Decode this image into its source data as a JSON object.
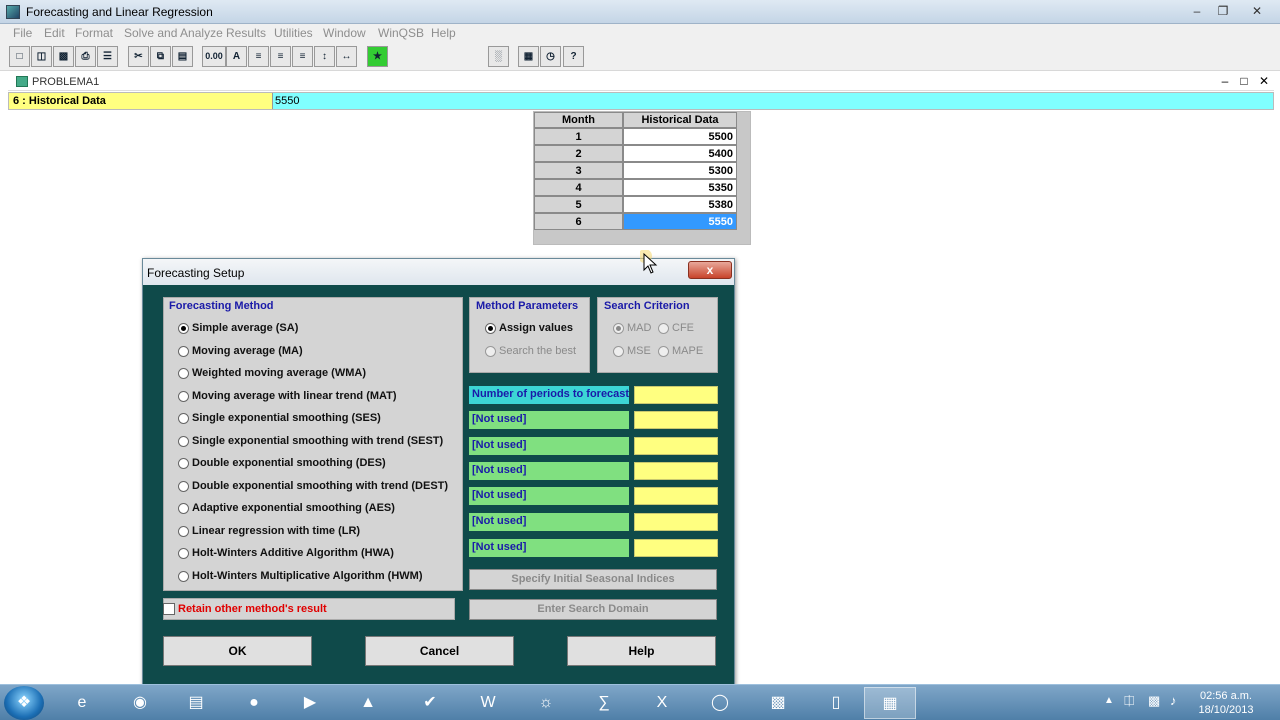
{
  "window": {
    "title": "Forecasting and Linear Regression"
  },
  "menu": [
    "File",
    "Edit",
    "Format",
    "Solve and Analyze",
    "Results",
    "Utilities",
    "Window",
    "WinQSB",
    "Help"
  ],
  "toolbar": {
    "zero_label": "0.00",
    "font_label": "A"
  },
  "child": {
    "title": "PROBLEMA1"
  },
  "cellbar": {
    "ref": "6 : Historical Data",
    "value": "5550"
  },
  "grid": {
    "headers": [
      "Month",
      "Historical Data"
    ],
    "rows": [
      {
        "month": "1",
        "value": "5500"
      },
      {
        "month": "2",
        "value": "5400"
      },
      {
        "month": "3",
        "value": "5300"
      },
      {
        "month": "4",
        "value": "5350"
      },
      {
        "month": "5",
        "value": "5380"
      },
      {
        "month": "6",
        "value": "5550"
      }
    ]
  },
  "dialog": {
    "title": "Forecasting Setup",
    "close": "x",
    "method_title": "Forecasting Method",
    "methods": [
      "Simple average (SA)",
      "Moving average (MA)",
      "Weighted moving average (WMA)",
      "Moving average with linear trend (MAT)",
      "Single exponential smoothing (SES)",
      "Single exponential smoothing with trend (SEST)",
      "Double exponential smoothing (DES)",
      "Double exponential smoothing with trend (DEST)",
      "Adaptive exponential smoothing (AES)",
      "Linear regression with time (LR)",
      "Holt-Winters Additive Algorithm (HWA)",
      "Holt-Winters Multiplicative Algorithm (HWM)"
    ],
    "params_title": "Method Parameters",
    "assign_values": "Assign values",
    "search_best": "Search the best",
    "criterion_title": "Search Criterion",
    "criteria": [
      "MAD",
      "CFE",
      "MSE",
      "MAPE"
    ],
    "param_labels": [
      "Number of periods to forecast",
      "[Not used]",
      "[Not used]",
      "[Not used]",
      "[Not used]",
      "[Not used]",
      "[Not used]"
    ],
    "seasonal_btn": "Specify Initial Seasonal Indices",
    "search_domain_btn": "Enter Search Domain",
    "retain_label": "Retain other method's result",
    "ok": "OK",
    "cancel": "Cancel",
    "help": "Help"
  },
  "taskbar": {
    "time": "02:56 a.m.",
    "date": "18/10/2013"
  },
  "colors": {
    "dialog_bg": "#0f4a4a",
    "param_label_bg": "#80e080",
    "param_value_bg": "#ffff80",
    "cellbar_bg": "#80ffff",
    "selected_cell": "#3399ff",
    "retain_text": "#e00000",
    "label_blue": "#1a1aa8"
  }
}
